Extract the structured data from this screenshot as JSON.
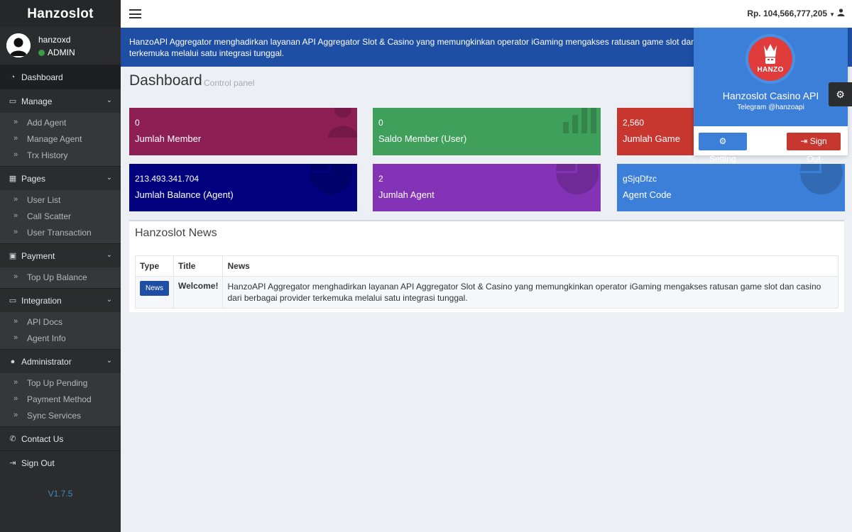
{
  "sidebar": {
    "logo": "Hanzoslot",
    "user": {
      "name": "hanzoxd",
      "role": "ADMIN"
    },
    "dashboard_label": "Dashboard",
    "manage": {
      "label": "Manage",
      "items": [
        "Add Agent",
        "Manage Agent",
        "Trx History"
      ]
    },
    "pages": {
      "label": "Pages",
      "items": [
        "User List",
        "Call Scatter",
        "User Transaction"
      ]
    },
    "payment": {
      "label": "Payment",
      "items": [
        "Top Up Balance"
      ]
    },
    "integration": {
      "label": "Integration",
      "items": [
        "API Docs",
        "Agent Info"
      ]
    },
    "administrator": {
      "label": "Administrator",
      "items": [
        "Top Up Pending",
        "Payment Method",
        "Sync Services"
      ]
    },
    "contact_label": "Contact Us",
    "signout_label": "Sign Out",
    "version": "V1.7.5"
  },
  "topbar": {
    "balance": "Rp. 104,566,777,205"
  },
  "banner": "HanzoAPI Aggregator menghadirkan layanan API Aggregator Slot & Casino yang memungkinkan operator iGaming mengakses ratusan game slot dan casino dari berbagai provider terkemuka melalui satu integrasi tunggal.",
  "header": {
    "title": "Dashboard",
    "subtitle": "Control panel"
  },
  "stats": [
    {
      "value": "0",
      "label": "Jumlah Member",
      "color": "#8e1f55"
    },
    {
      "value": "0",
      "label": "Saldo Member (User)",
      "color": "#3ea05b"
    },
    {
      "value": "2,560",
      "label": "Jumlah Game",
      "color": "#c7372f"
    },
    {
      "value": "213.493.341.704",
      "label": "Jumlah Balance (Agent)",
      "color": "#02027f"
    },
    {
      "value": "2",
      "label": "Jumlah Agent",
      "color": "#8533b6"
    },
    {
      "value": "gSjqDfzc",
      "label": "Agent Code",
      "color": "#3c7fd8"
    }
  ],
  "news": {
    "title": "Hanzoslot News",
    "columns": [
      "Type",
      "Title",
      "News"
    ],
    "rows": [
      {
        "type": "News",
        "title": "Welcome!",
        "news": "HanzoAPI Aggregator menghadirkan layanan API Aggregator Slot & Casino yang memungkinkan operator iGaming mengakses ratusan game slot dan casino dari berbagai provider terkemuka melalui satu integrasi tunggal."
      }
    ]
  },
  "profile_dropdown": {
    "logo_text": "HANZO",
    "name": "Hanzoslot Casino API",
    "telegram": "Telegram @hanzoapi",
    "setting_label": "Setting",
    "signout_label": "Sign Out"
  }
}
